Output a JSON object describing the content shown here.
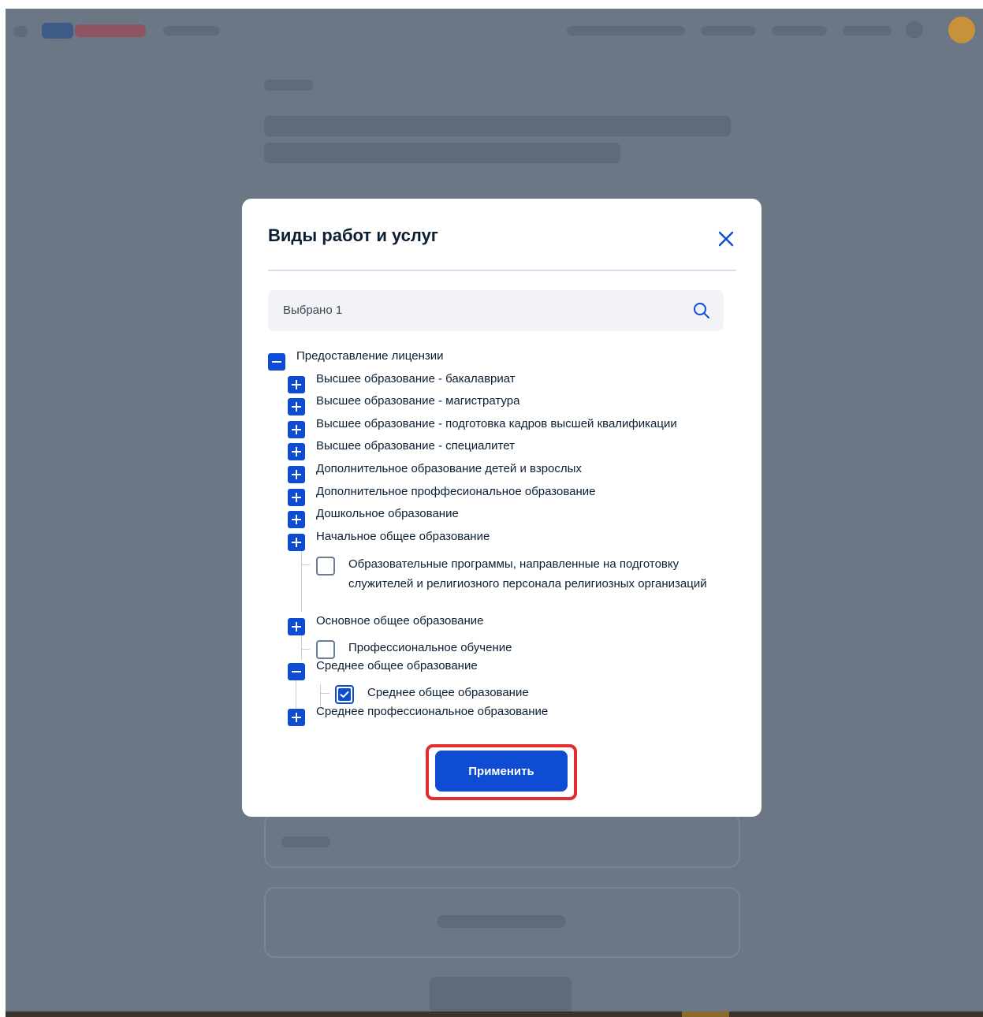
{
  "modal": {
    "title": "Виды работ и услуг",
    "close_icon": "close-icon",
    "search_value": "Выбрано 1",
    "search_icon": "search-icon",
    "apply_label": "Применить"
  },
  "tree": {
    "root_label": "Предоставление лицензии",
    "items": [
      {
        "label": "Высшее образование - бакалавриат",
        "state": "collapsed"
      },
      {
        "label": "Высшее образование - магистратура",
        "state": "collapsed"
      },
      {
        "label": "Высшее образование - подготовка кадров высшей квалификации",
        "state": "collapsed"
      },
      {
        "label": "Высшее образование - специалитет",
        "state": "collapsed"
      },
      {
        "label": "Дополнительное образование детей и взрослых",
        "state": "collapsed"
      },
      {
        "label": "Дополнительное проффесиональное образование",
        "state": "collapsed"
      },
      {
        "label": "Дошкольное образование",
        "state": "collapsed"
      },
      {
        "label": "Начальное общее образование",
        "state": "collapsed"
      },
      {
        "label": "Основное общее образование",
        "state": "collapsed"
      },
      {
        "label": "Среднее общее образование",
        "state": "expanded"
      },
      {
        "label": "Среднее профессиональное образование",
        "state": "collapsed"
      }
    ],
    "leaves": [
      {
        "label": "Образовательные программы, направленные на подготовку служителей и религиозного персонала религиозных организаций",
        "checked": false
      },
      {
        "label": "Профессиональное обучение",
        "checked": false
      },
      {
        "label": "Среднее общее образование",
        "checked": true
      }
    ]
  },
  "colors": {
    "primary": "#0d4cd3",
    "overlay": "#6b7784",
    "highlight": "#e12d2d"
  }
}
